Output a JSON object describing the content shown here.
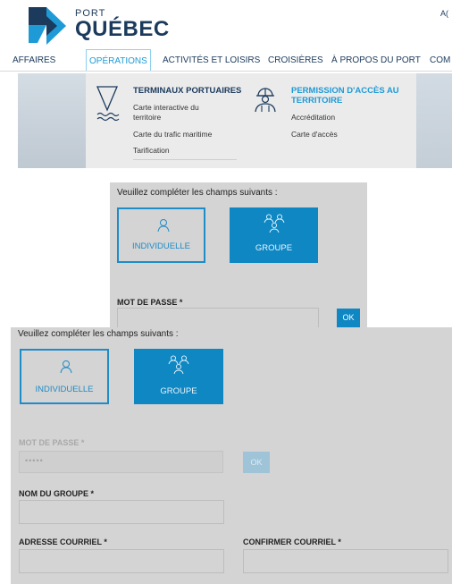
{
  "header": {
    "logo_top": "PORT",
    "logo_main": "QUÉBEC",
    "corner_text": "A("
  },
  "nav": {
    "items": [
      "AFFAIRES",
      "OPÉRATIONS",
      "ACTIVITÉS ET LOISIRS",
      "CROISIÈRES",
      "À PROPOS DU PORT",
      "COM"
    ],
    "active": "OPÉRATIONS"
  },
  "mega_menu": {
    "col1": {
      "title": "TERMINAUX PORTUAIRES",
      "links": [
        "Carte interactive du",
        "territoire",
        "Carte du trafic maritime",
        "Tarification"
      ]
    },
    "col2": {
      "title_line1": "PERMISSION D'ACCÈS AU",
      "title_line2": "TERRITOIRE",
      "links": [
        "Accréditation",
        "Carte d'accès"
      ]
    }
  },
  "form1": {
    "intro": "Veuillez compléter les champs suivants :",
    "individual_label": "INDIVIDUELLE",
    "group_label": "GROUPE",
    "password_label": "MOT DE PASSE *",
    "ok_label": "OK"
  },
  "form2": {
    "intro": "Veuillez compléter les champs suivants :",
    "individual_label": "INDIVIDUELLE",
    "group_label": "GROUPE",
    "password_label": "MOT DE PASSE *",
    "password_value": "•••••",
    "ok_label": "OK",
    "group_name_label": "NOM DU GROUPE *",
    "email_label": "ADRESSE COURRIEL *",
    "confirm_email_label": "CONFIRMER COURRIEL *"
  },
  "colors": {
    "brand_navy": "#1b3a5c",
    "accent_blue": "#1e9ad6",
    "selected_fill": "#0f87c3",
    "panel_gray": "#d4d4d4"
  }
}
